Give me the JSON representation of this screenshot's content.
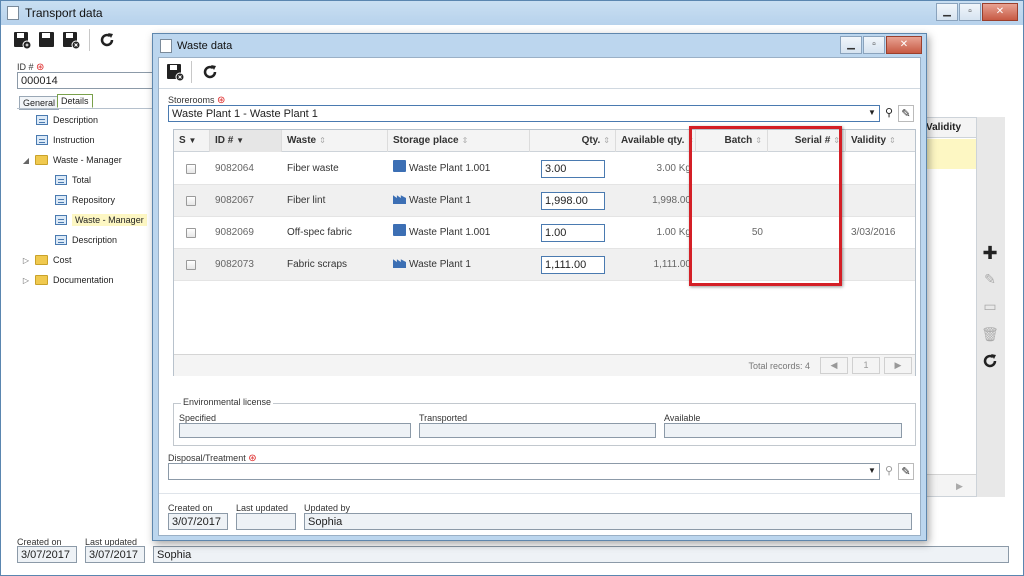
{
  "outer": {
    "title": "Transport data",
    "controls": [
      "▁",
      "▫",
      "✕"
    ],
    "id_label": "ID #",
    "id_value": "000014",
    "tabs": [
      "General",
      "Details"
    ],
    "tree": [
      {
        "label": "Description",
        "icon": "doc-icon"
      },
      {
        "label": "Instruction",
        "icon": "doc-icon"
      },
      {
        "label": "Waste - Manager",
        "icon": "folder-icon"
      },
      {
        "label": "Total",
        "icon": "doc-icon"
      },
      {
        "label": "Repository",
        "icon": "doc-icon"
      },
      {
        "label": "Waste - Manager",
        "icon": "doc-icon"
      },
      {
        "label": "Description",
        "icon": "doc-icon"
      },
      {
        "label": "Cost",
        "icon": "folder-icon"
      },
      {
        "label": "Documentation",
        "icon": "folder-icon"
      }
    ],
    "right_col_header": "Validity",
    "footer": {
      "created_on_label": "Created on",
      "created_on": "3/07/2017",
      "last_updated_label": "Last updated",
      "last_updated": "3/07/2017",
      "updated_by": "Sophia"
    }
  },
  "dialog": {
    "title": "Waste data",
    "controls": [
      "▁",
      "▫",
      "✕"
    ],
    "storerooms_label": "Storerooms",
    "storerooms_value": "Waste Plant 1 - Waste Plant 1",
    "grid": {
      "columns": [
        "S",
        "ID #",
        "Waste",
        "Storage place",
        "Qty.",
        "Available qty.",
        "Batch",
        "Serial #",
        "Validity"
      ],
      "rows": [
        {
          "id": "9082064",
          "waste": "Fiber waste",
          "storage": "Waste Plant 1.001",
          "storage_icon": "store-icon",
          "qty": "3.00",
          "available": "3.00 Kg",
          "batch": "",
          "serial": "",
          "validity": ""
        },
        {
          "id": "9082067",
          "waste": "Fiber lint",
          "storage": "Waste Plant 1",
          "storage_icon": "factory-icon",
          "qty": "1,998.00",
          "available": "1,998.00",
          "batch": "",
          "serial": "",
          "validity": ""
        },
        {
          "id": "9082069",
          "waste": "Off-spec fabric",
          "storage": "Waste Plant 1.001",
          "storage_icon": "store-icon",
          "qty": "1.00",
          "available": "1.00 Kg",
          "batch": "50",
          "serial": "",
          "validity": "3/03/2016"
        },
        {
          "id": "9082073",
          "waste": "Fabric scraps",
          "storage": "Waste Plant 1",
          "storage_icon": "factory-icon",
          "qty": "1,111.00",
          "available": "1,111.00",
          "batch": "",
          "serial": "",
          "validity": ""
        }
      ],
      "total_records": "Total records: 4",
      "page": "1"
    },
    "env": {
      "legend": "Environmental license",
      "specified": "Specified",
      "transported": "Transported",
      "available": "Available"
    },
    "disposal_label": "Disposal/Treatment",
    "footer": {
      "created_on_label": "Created on",
      "created_on": "3/07/2017",
      "last_updated_label": "Last updated",
      "last_updated": "",
      "updated_by_label": "Updated by",
      "updated_by": "Sophia"
    }
  },
  "colors": {
    "accent": "#3c6fb4",
    "highlight": "#d41f26",
    "selected": "#fdf7c3"
  }
}
